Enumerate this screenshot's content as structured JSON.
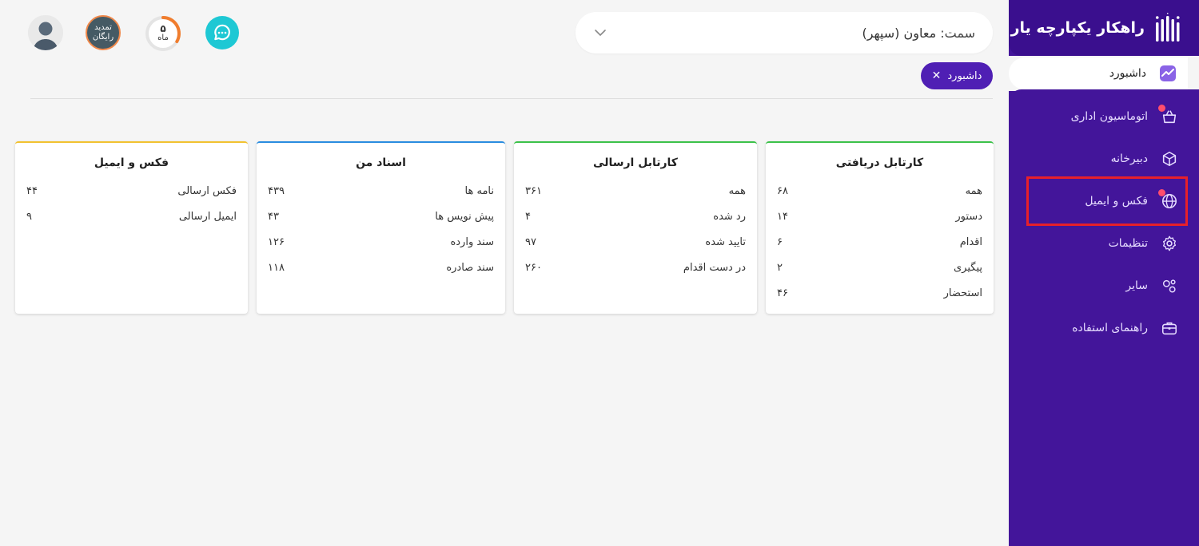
{
  "brand": {
    "title": "راهکار یکپارچه یار"
  },
  "sidebar": {
    "active": {
      "label": "داشبورد",
      "icon": "chart-icon"
    },
    "items": [
      {
        "label": "اتوماسیون اداری",
        "icon": "basket-icon",
        "badge": true
      },
      {
        "label": "دبیرخانه",
        "icon": "box-icon",
        "badge": false
      },
      {
        "label": "فکس و ایمیل",
        "icon": "globe-icon",
        "badge": true
      },
      {
        "label": "تنظیمات",
        "icon": "gear-icon",
        "badge": false
      },
      {
        "label": "سایر",
        "icon": "circles-icon",
        "badge": false
      },
      {
        "label": "راهنمای استفاده",
        "icon": "briefcase-icon",
        "badge": false
      }
    ]
  },
  "header": {
    "role_label": "سمت:",
    "role_value": "معاون (سپهر)",
    "tab_label": "داشبورد",
    "renew_line1": "تمدید",
    "renew_line2": "رایگان",
    "months_value": "۵",
    "months_unit": "ماه"
  },
  "colors": {
    "sidebar": "#43159a",
    "accent": "#4f1fb4",
    "highlight": "#e8202a",
    "card_green": "#3cc24a",
    "card_blue": "#2a8de0",
    "card_yellow": "#f2c230"
  },
  "cards": [
    {
      "title": "کارتابل دریافتی",
      "rows": [
        {
          "label": "همه",
          "value": "۶۸"
        },
        {
          "label": "دستور",
          "value": "۱۴"
        },
        {
          "label": "اقدام",
          "value": "۶"
        },
        {
          "label": "پیگیری",
          "value": "۲"
        },
        {
          "label": "استحضار",
          "value": "۴۶"
        }
      ]
    },
    {
      "title": "کارتابل ارسالی",
      "rows": [
        {
          "label": "همه",
          "value": "۳۶۱"
        },
        {
          "label": "رد شده",
          "value": "۴"
        },
        {
          "label": "تایید شده",
          "value": "۹۷"
        },
        {
          "label": "در دست اقدام",
          "value": "۲۶۰"
        }
      ]
    },
    {
      "title": "اسناد من",
      "rows": [
        {
          "label": "نامه ها",
          "value": "۴۳۹"
        },
        {
          "label": "پیش نویس ها",
          "value": "۴۳"
        },
        {
          "label": "سند وارده",
          "value": "۱۲۶"
        },
        {
          "label": "سند صادره",
          "value": "۱۱۸"
        }
      ]
    },
    {
      "title": "فکس و ایمیل",
      "rows": [
        {
          "label": "فکس ارسالی",
          "value": "۴۴"
        },
        {
          "label": "ایمیل ارسالی",
          "value": "۹"
        }
      ]
    }
  ]
}
